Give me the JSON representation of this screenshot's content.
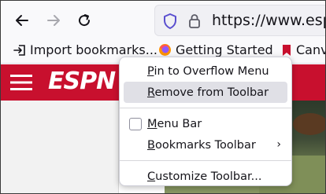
{
  "navbar": {
    "url_text": "https://www.espn.c"
  },
  "bookmarks": {
    "items": [
      {
        "label": "Import bookmarks..."
      },
      {
        "label": "Getting Started"
      },
      {
        "label": "Canva"
      }
    ]
  },
  "page": {
    "logo": "ESPN"
  },
  "context_menu": {
    "items": [
      {
        "label": "Pin to Overflow Menu",
        "access_key": "P",
        "rest": "in to Overflow Menu"
      },
      {
        "label": "Remove from Toolbar",
        "access_key": "R",
        "rest": "emove from Toolbar"
      },
      {
        "label": "Menu Bar",
        "access_key": "M",
        "rest": "enu Bar",
        "checked": false
      },
      {
        "label": "Bookmarks Toolbar",
        "access_key": "B",
        "rest": "ookmarks Toolbar",
        "submenu_arrow": "›"
      },
      {
        "label": "Customize Toolbar...",
        "access_key": "C",
        "rest": "ustomize Toolbar..."
      }
    ]
  }
}
